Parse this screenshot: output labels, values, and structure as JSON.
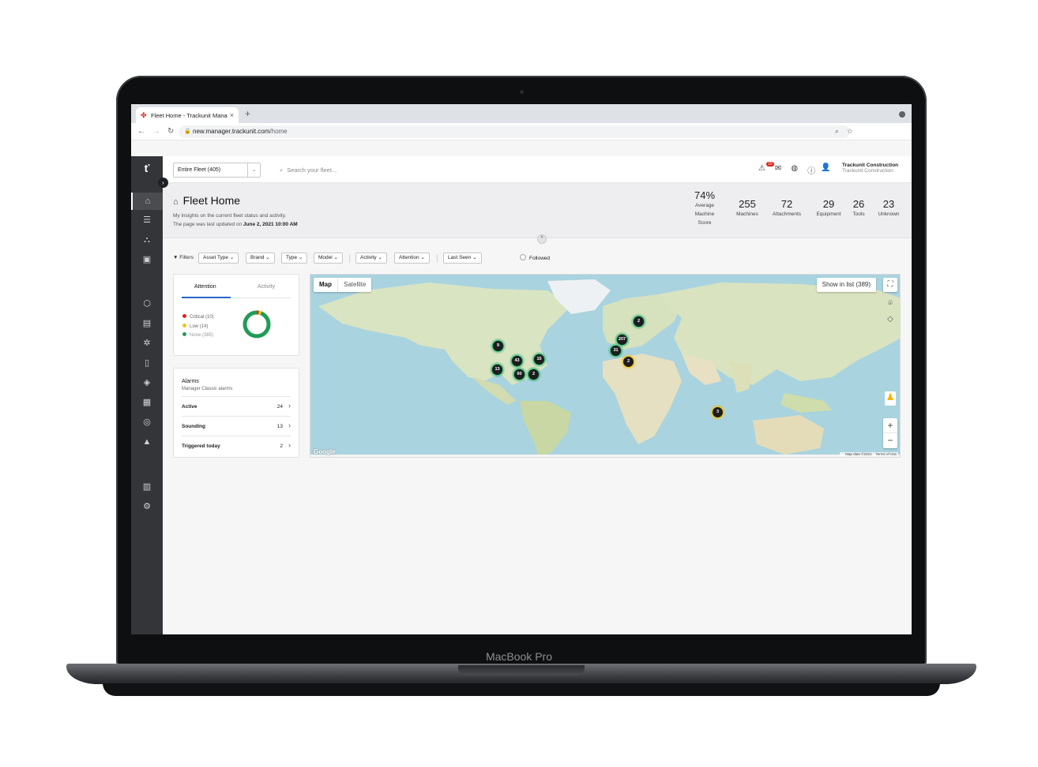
{
  "device_label": "MacBook Pro",
  "browser": {
    "tab_title": "Fleet Home - Trackunit Manag",
    "url_domain": "new.manager.trackunit.com",
    "url_path": "/home"
  },
  "topbar": {
    "fleet_select": "Entire Fleet (405)",
    "search_placeholder": "Search your fleet...",
    "alert_badge": "10",
    "user_name": "Trackunit Construction",
    "user_org": "Trackunit Construction"
  },
  "header": {
    "title": "Fleet Home",
    "subtitle": "My insights on the current fleet status and activity.",
    "updated_prefix": "The page was last updated on",
    "updated_date": "June 2, 2021 10:00 AM",
    "stats": [
      {
        "value": "74%",
        "label_lines": [
          "Average",
          "Machine",
          "Score"
        ]
      },
      {
        "value": "255",
        "label": "Machines"
      },
      {
        "value": "72",
        "label": "Attachments"
      },
      {
        "value": "29",
        "label": "Equipment"
      },
      {
        "value": "26",
        "label": "Tools"
      },
      {
        "value": "23",
        "label": "Unknown"
      }
    ]
  },
  "filters": {
    "label": "Filters",
    "chips": [
      "Asset Type",
      "Brand",
      "Type",
      "Model",
      "Activity",
      "Attention",
      "Last Seen"
    ],
    "followed": "Followed"
  },
  "attention": {
    "tabs": [
      "Attention",
      "Activity"
    ],
    "legend": [
      {
        "label": "Critical (10)",
        "color": "#e2231a",
        "count": 10
      },
      {
        "label": "Low (14)",
        "color": "#f1c40f",
        "count": 14
      },
      {
        "label": "None (385)",
        "color": "#1f9d55",
        "count": 385
      }
    ]
  },
  "alarms": {
    "title": "Alarms",
    "subtitle": "Manager Classic alarms",
    "rows": [
      {
        "label": "Active",
        "count": "24"
      },
      {
        "label": "Sounding",
        "count": "13"
      },
      {
        "label": "Triggered today",
        "count": "2"
      }
    ]
  },
  "map": {
    "tabs": [
      "Map",
      "Satellite"
    ],
    "show_in_list": "Show in list (389)",
    "google_logo": "Google",
    "attribution": [
      "Map data ©2021",
      "Terms of Use"
    ],
    "clusters": [
      "2",
      "9",
      "207",
      "31",
      "2",
      "43",
      "15",
      "13",
      "60",
      "2",
      "3"
    ],
    "colors": {
      "ok": "#2fb36f",
      "warning": "#f1c40f",
      "water": "#a9d3df"
    }
  }
}
